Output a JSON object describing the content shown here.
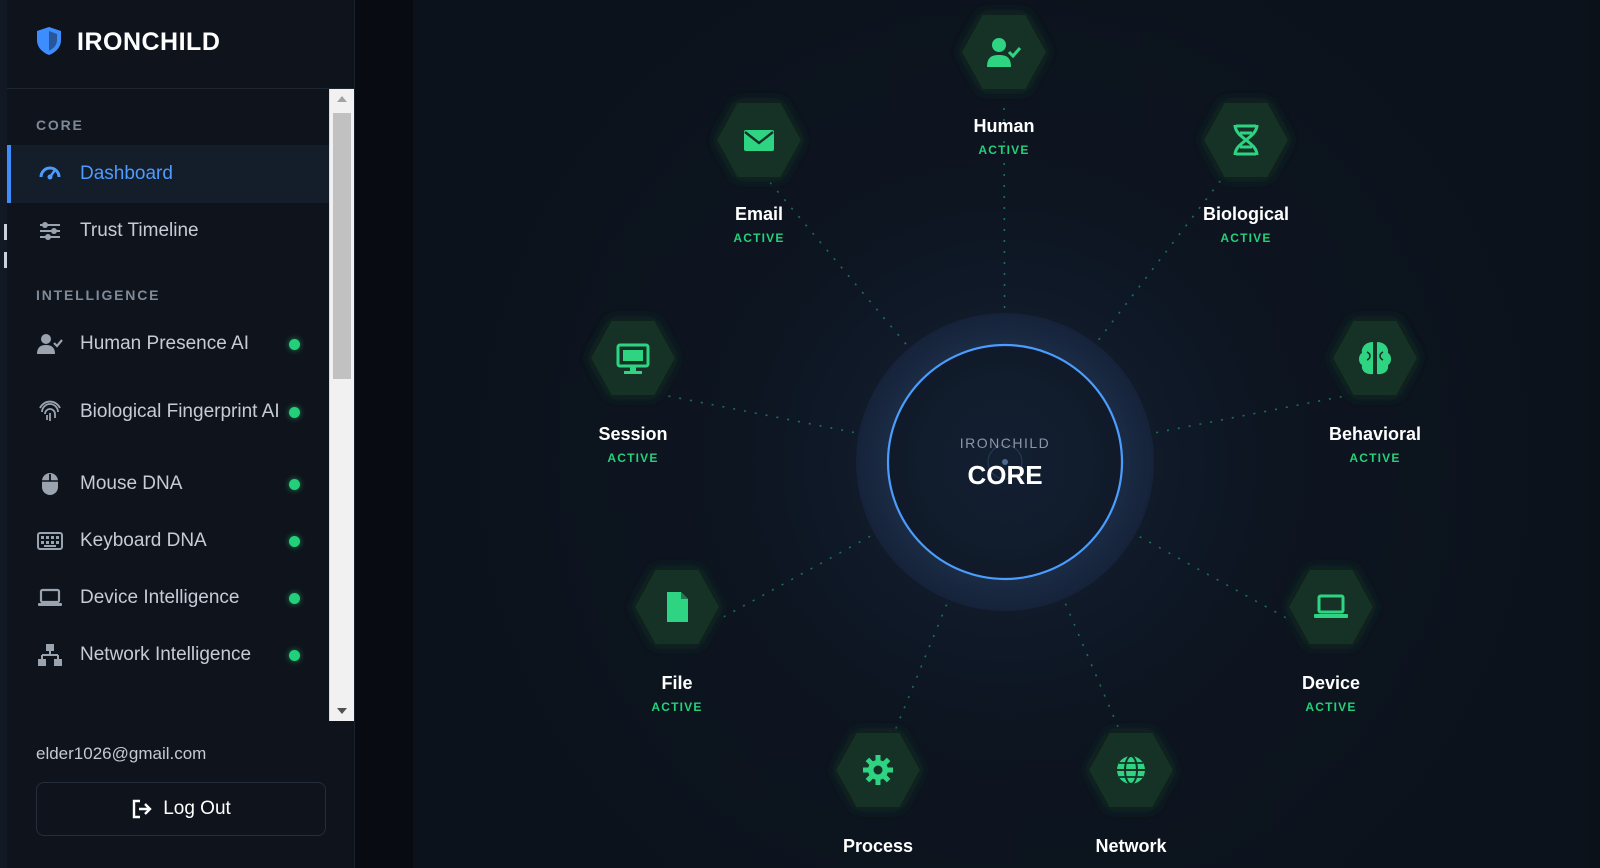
{
  "brand": {
    "name": "IRONCHILD"
  },
  "sidebar": {
    "sections": [
      {
        "label": "CORE"
      },
      {
        "label": "INTELLIGENCE"
      }
    ],
    "items": [
      {
        "label": "Dashboard",
        "icon": "gauge-icon",
        "active": true
      },
      {
        "label": "Trust Timeline",
        "icon": "sliders-icon"
      },
      {
        "label": "Human Presence AI",
        "icon": "user-check-icon",
        "status": "online"
      },
      {
        "label": "Biological Fingerprint AI",
        "icon": "fingerprint-icon",
        "status": "online"
      },
      {
        "label": "Mouse DNA",
        "icon": "mouse-icon",
        "status": "online"
      },
      {
        "label": "Keyboard DNA",
        "icon": "keyboard-icon",
        "status": "online"
      },
      {
        "label": "Device Intelligence",
        "icon": "laptop-icon",
        "status": "online"
      },
      {
        "label": "Network Intelligence",
        "icon": "network-icon",
        "status": "online"
      }
    ],
    "user_email": "elder1026@gmail.com",
    "logout_label": "Log Out"
  },
  "core": {
    "caption": "IRONCHILD",
    "title": "CORE"
  },
  "modules": [
    {
      "name": "Human",
      "status": "ACTIVE",
      "icon": "user-check-icon"
    },
    {
      "name": "Biological",
      "status": "ACTIVE",
      "icon": "dna-icon"
    },
    {
      "name": "Behavioral",
      "status": "ACTIVE",
      "icon": "brain-icon"
    },
    {
      "name": "Device",
      "status": "ACTIVE",
      "icon": "laptop-icon"
    },
    {
      "name": "Network",
      "status": "",
      "icon": "globe-icon"
    },
    {
      "name": "Process",
      "status": "",
      "icon": "gear-icon"
    },
    {
      "name": "File",
      "status": "ACTIVE",
      "icon": "file-icon"
    },
    {
      "name": "Session",
      "status": "ACTIVE",
      "icon": "monitor-icon"
    },
    {
      "name": "Email",
      "status": "ACTIVE",
      "icon": "envelope-icon"
    }
  ],
  "colors": {
    "accent": "#3d8dff",
    "status_active": "#25d07b",
    "module_icon": "#2fd483",
    "background": "#0c121b"
  }
}
